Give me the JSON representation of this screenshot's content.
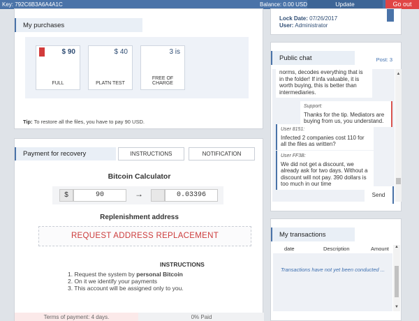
{
  "topbar": {
    "key_label": "Key: 792C6B3A6A4A1C",
    "balance_label": "Balance: 0.00 USD",
    "update_label": "Update",
    "goout_label": "Go out"
  },
  "purchases": {
    "title": "My purchases",
    "items": [
      {
        "price": "$ 90",
        "label": "FULL"
      },
      {
        "price": "$ 40",
        "label": "PLATN TEST"
      },
      {
        "price": "3 is",
        "label": "FREE OF CHARGE"
      }
    ],
    "tip_prefix": "Tip:",
    "tip_text": "To restore all the files, you have to pay 90 USD."
  },
  "payment": {
    "title": "Payment for recovery",
    "tabs": [
      "INSTRUCTIONS",
      "NOTIFICATION"
    ],
    "calc_title": "Bitcoin Calculator",
    "usd_symbol": "$",
    "usd_value": "90",
    "arrow": "→",
    "btc_value": "0.03396",
    "replenish_title": "Replenishment address",
    "request_label": "REQUEST ADDRESS REPLACEMENT",
    "instructions_title": "INSTRUCTIONS",
    "instructions": {
      "step1_prefix": "1. Request the system by ",
      "step1_bold": "personal Bitcoin",
      "step2": "2. On it we identify your payments",
      "step3": "3. This account will be assigned only to you."
    },
    "terms": "Terms of payment: 4 days.",
    "paid": "0% Paid"
  },
  "lock": {
    "date_label": "Lock Date:",
    "date_value": "07/26/2017",
    "user_label": "User:",
    "user_value": "Administrator"
  },
  "chat": {
    "title": "Public chat",
    "post_count": "Post: 3",
    "messages": [
      {
        "author": "",
        "text": "norms, decodes everything that is in the folder! If infa valuable, it is worth buying, this is better than intermediaries."
      },
      {
        "author": "Support:",
        "text": "Thanks for the tip. Mediators are buying from us, you understand."
      },
      {
        "author": "User 8151:",
        "text": "Infected 2 companies cost 110 for all the files as written?"
      },
      {
        "author": "User FF3B:",
        "text": "We did not get a discount, we already ask for two days. Without a discount will not pay. 390 dollars is too much in our time"
      }
    ],
    "send_label": "Send"
  },
  "transactions": {
    "title": "My transactions",
    "columns": [
      "date",
      "Description",
      "Amount"
    ],
    "empty_text": "Transactions have not yet been conducted ..."
  },
  "colors": {
    "accent": "#4a73a8",
    "danger": "#e04545",
    "request_text": "#cc3b3b"
  }
}
